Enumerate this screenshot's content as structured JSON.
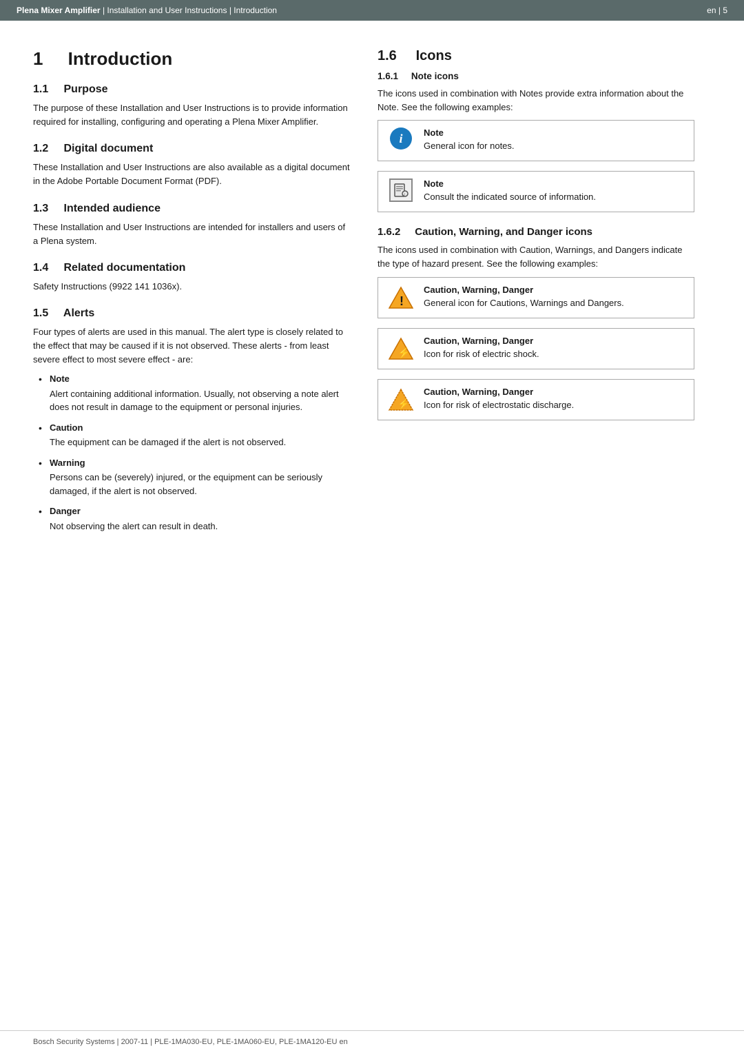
{
  "header": {
    "product": "Plena Mixer Amplifier",
    "separator1": " | ",
    "subtitle": "Installation and User Instructions | Introduction",
    "lang": "en",
    "page": "5"
  },
  "main_section": {
    "number": "1",
    "title": "Introduction"
  },
  "left": {
    "sections": [
      {
        "id": "1.1",
        "title": "Purpose",
        "text": "The purpose of these Installation and User Instructions is to provide information required for installing, configuring and operating a Plena Mixer Amplifier."
      },
      {
        "id": "1.2",
        "title": "Digital document",
        "text": "These Installation and User Instructions are also available as a digital document in the Adobe Portable Document Format (PDF)."
      },
      {
        "id": "1.3",
        "title": "Intended audience",
        "text": "These Installation and User Instructions are intended for installers and users of a Plena system."
      },
      {
        "id": "1.4",
        "title": "Related documentation",
        "text": "Safety Instructions (9922 141 1036x)."
      },
      {
        "id": "1.5",
        "title": "Alerts",
        "intro": "Four types of alerts are used in this manual. The alert type is closely related to the effect that may be caused if it is not observed. These alerts - from least severe effect to most severe effect - are:",
        "alerts": [
          {
            "term": "Note",
            "description": "Alert containing additional information. Usually, not observing a note alert does not result in damage to the equipment or personal injuries."
          },
          {
            "term": "Caution",
            "description": "The equipment can be damaged if the alert is not observed."
          },
          {
            "term": "Warning",
            "description": "Persons can be (severely) injured, or the equipment can be seriously damaged, if the alert is not observed."
          },
          {
            "term": "Danger",
            "description": "Not observing the alert can result in death."
          }
        ]
      }
    ]
  },
  "right": {
    "section_number": "1.6",
    "section_title": "Icons",
    "subsections": [
      {
        "id": "1.6.1",
        "title": "Note icons",
        "intro": "The icons used in combination with Notes provide extra information about the Note. See the following examples:",
        "boxes": [
          {
            "icon_type": "info_circle",
            "title": "Note",
            "text": "General icon for notes."
          },
          {
            "icon_type": "book",
            "title": "Note",
            "text": "Consult the indicated source of information."
          }
        ]
      },
      {
        "id": "1.6.2",
        "title": "Caution, Warning, and Danger icons",
        "intro": "The icons used in combination with Caution, Warnings, and Dangers indicate the type of hazard present. See the following examples:",
        "boxes": [
          {
            "icon_type": "warning_general",
            "title": "Caution, Warning, Danger",
            "text": "General icon for Cautions, Warnings and Dangers."
          },
          {
            "icon_type": "warning_electric",
            "title": "Caution, Warning, Danger",
            "text": "Icon for risk of electric shock."
          },
          {
            "icon_type": "warning_static",
            "title": "Caution, Warning, Danger",
            "text": "Icon for risk of electrostatic discharge."
          }
        ]
      }
    ]
  },
  "footer": {
    "text": "Bosch Security Systems | 2007-11 | PLE-1MA030-EU,  PLE-1MA060-EU, PLE-1MA120-EU en"
  }
}
